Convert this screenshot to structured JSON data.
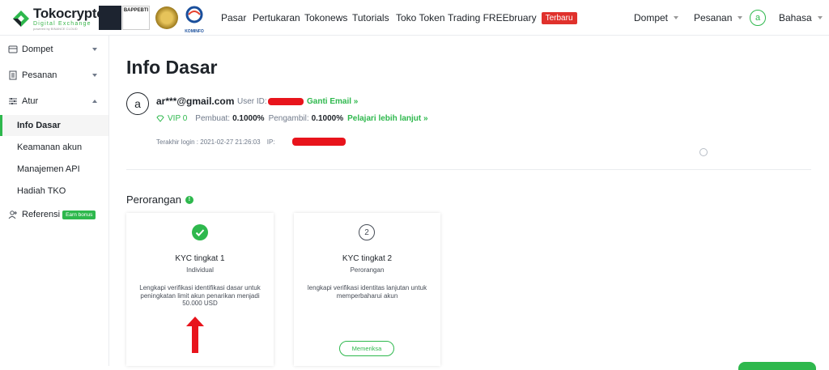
{
  "brand": {
    "name": "Tokocrypto",
    "tagline": "Digital Exchange",
    "tagline2": "powered by BINANCE CLOUD",
    "partner_bappebti": "BAPPEBTI",
    "partner_kominfo": "KOMINFO"
  },
  "nav": {
    "items": [
      "Pasar",
      "Pertukaran",
      "Tokonews",
      "Tutorials",
      "Toko Token",
      "Trading FREEbruary"
    ],
    "new_badge": "Terbaru",
    "wallet": "Dompet",
    "orders": "Pesanan",
    "avatar_letter": "a",
    "language": "Bahasa"
  },
  "sidebar": {
    "wallet": "Dompet",
    "orders": "Pesanan",
    "settings": "Atur",
    "sub_items": [
      "Info Dasar",
      "Keamanan akun",
      "Manajemen API",
      "Hadiah TKO"
    ],
    "referral": "Referensi",
    "earn_badge": "Earn bonus"
  },
  "profile": {
    "title": "Info Dasar",
    "avatar_letter": "a",
    "email": "ar***@gmail.com",
    "user_id_label": "User ID:",
    "change_email": "Ganti Email »",
    "vip": "VIP 0",
    "maker_label": "Pembuat:",
    "maker_fee": "0.1000%",
    "taker_label": "Pengambil:",
    "taker_fee": "0.1000%",
    "learn_more": "Pelajari lebih lanjut »",
    "last_login": "Terakhir login : 2021-02-27 21:26:03",
    "ip_label": "IP:"
  },
  "section": {
    "title": "Perorangan",
    "info_icon": "!"
  },
  "cards": [
    {
      "title": "KYC tingkat 1",
      "subtitle": "Individual",
      "description": "Lengkapi verifikasi identifikasi dasar untuk peningkatan limit akun penarikan menjadi 50.000 USD",
      "status": "complete"
    },
    {
      "number": "2",
      "title": "KYC tingkat 2",
      "subtitle": "Perorangan",
      "description": "lengkapi verifikasi identitas lanjutan untuk memperbaharui akun",
      "button": "Memeriksa"
    }
  ],
  "colors": {
    "accent_green": "#2eb84d",
    "badge_red": "#e0312c",
    "redaction_red": "#e8141c"
  }
}
